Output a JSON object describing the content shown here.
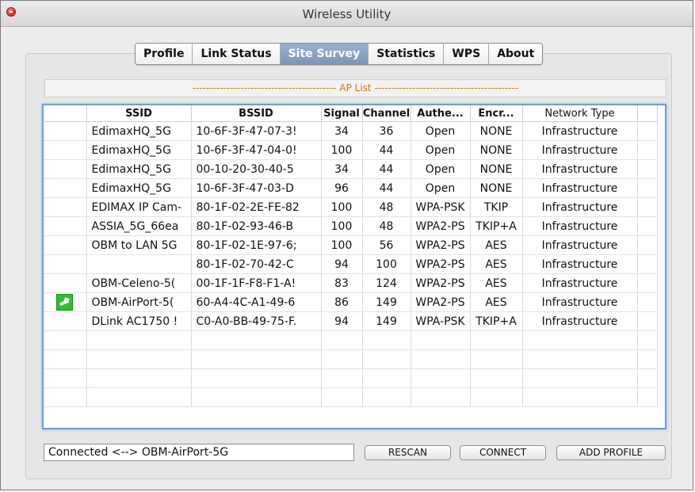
{
  "window": {
    "title": "Wireless Utility"
  },
  "tabs": [
    "Profile",
    "Link Status",
    "Site Survey",
    "Statistics",
    "WPS",
    "About"
  ],
  "active_tab": "Site Survey",
  "ap_list": {
    "banner": "AP List"
  },
  "table": {
    "columns": [
      "",
      "SSID",
      "BSSID",
      "Signal",
      "Channel",
      "Authe...",
      "Encr...",
      "Network Type"
    ],
    "rows": [
      [
        "",
        "EdimaxHQ_5G",
        "10-6F-3F-47-07-3!",
        "34",
        "36",
        "Open",
        "NONE",
        "Infrastructure"
      ],
      [
        "",
        "EdimaxHQ_5G",
        "10-6F-3F-47-04-0!",
        "100",
        "44",
        "Open",
        "NONE",
        "Infrastructure"
      ],
      [
        "",
        "EdimaxHQ_5G",
        "00-10-20-30-40-5",
        "34",
        "44",
        "Open",
        "NONE",
        "Infrastructure"
      ],
      [
        "",
        "EdimaxHQ_5G",
        "10-6F-3F-47-03-D",
        "96",
        "44",
        "Open",
        "NONE",
        "Infrastructure"
      ],
      [
        "",
        "EDIMAX IP Cam-",
        "80-1F-02-2E-FE-82",
        "100",
        "48",
        "WPA-PSK",
        "TKIP",
        "Infrastructure"
      ],
      [
        "",
        "ASSIA_5G_66ea",
        "80-1F-02-93-46-B",
        "100",
        "48",
        "WPA2-PS",
        "TKIP+A",
        "Infrastructure"
      ],
      [
        "",
        "OBM to LAN 5G",
        "80-1F-02-1E-97-6;",
        "100",
        "56",
        "WPA2-PS",
        "AES",
        "Infrastructure"
      ],
      [
        "",
        "",
        "80-1F-02-70-42-C",
        "94",
        "100",
        "WPA2-PS",
        "AES",
        "Infrastructure"
      ],
      [
        "",
        "OBM-Celeno-5(",
        "00-1F-1F-F8-F1-A!",
        "83",
        "124",
        "WPA2-PS",
        "AES",
        "Infrastructure"
      ],
      [
        "connected-icon",
        "OBM-AirPort-5(",
        "60-A4-4C-A1-49-6",
        "86",
        "149",
        "WPA2-PS",
        "AES",
        "Infrastructure"
      ],
      [
        "",
        "DLink AC1750 !",
        "C0-A0-BB-49-75-F.",
        "94",
        "149",
        "WPA-PSK",
        "TKIP+A",
        "Infrastructure"
      ],
      [
        "",
        "",
        "",
        "",
        "",
        "",
        "",
        ""
      ],
      [
        "",
        "",
        "",
        "",
        "",
        "",
        "",
        ""
      ],
      [
        "",
        "",
        "",
        "",
        "",
        "",
        "",
        ""
      ],
      [
        "",
        "",
        "",
        "",
        "",
        "",
        "",
        ""
      ]
    ]
  },
  "status": {
    "text": "Connected <--> OBM-AirPort-5G"
  },
  "buttons": {
    "rescan": "RESCAN",
    "connect": "CONNECT",
    "add_profile": "ADD PROFILE"
  },
  "colors": {
    "active_tab": "#8aa2c4",
    "table_focus_border": "#6a9fd8",
    "banner_text": "#c87a1e",
    "connected_icon": "#2fbf2f"
  }
}
